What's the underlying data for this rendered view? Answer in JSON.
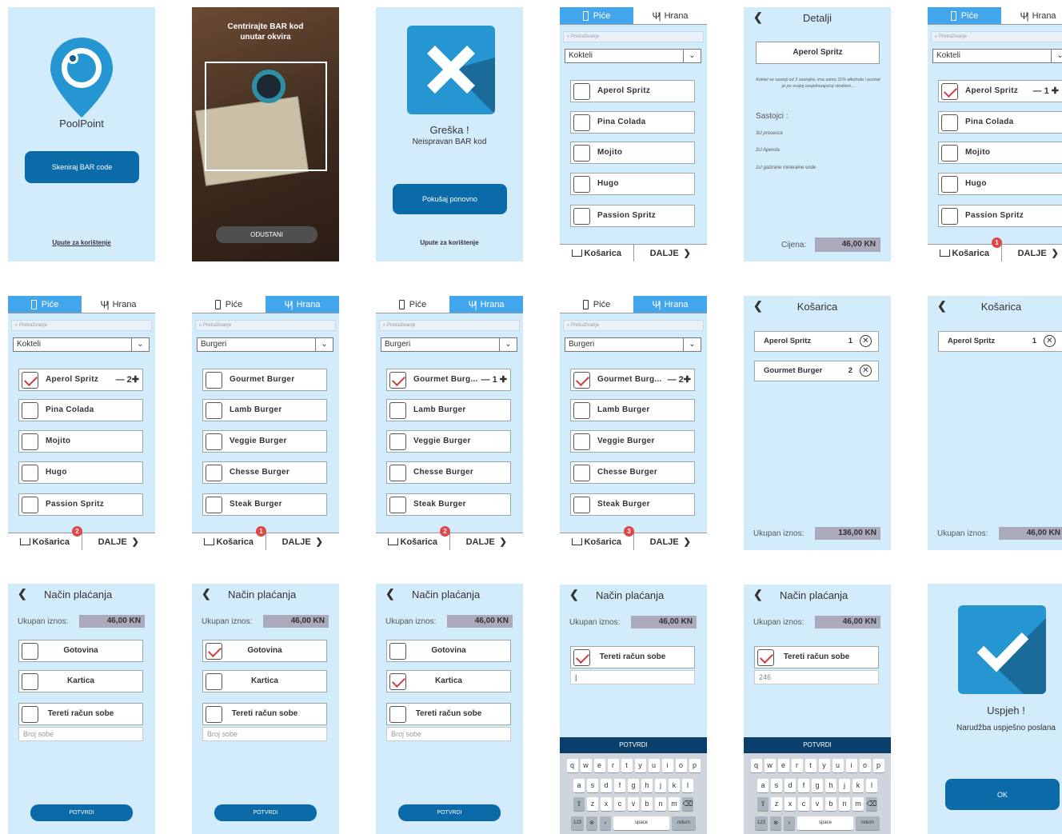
{
  "app": {
    "name": "PoolPoint",
    "scan_button": "Skeniraj BAR code",
    "instructions_link": "Upute za korištenje"
  },
  "scan": {
    "prompt": "Centrirajte BAR kod unutar okvira",
    "cancel": "ODUSTANI"
  },
  "error": {
    "title": "Greška !",
    "message": "Neispravan BAR kod",
    "retry": "Pokušaj ponovno",
    "instructions_link": "Upute za korištenje"
  },
  "tabs": {
    "drinks": "Piće",
    "food": "Hrana"
  },
  "search_placeholder": "Pretraživanje",
  "categories": {
    "cocktails": "Kokteli",
    "burgers": "Burgeri"
  },
  "cocktails": [
    "Aperol Spritz",
    "Pina Colada",
    "Mojito",
    "Hugo",
    "Passion Spritz"
  ],
  "burgers": [
    "Gourmet Burger",
    "Lamb Burger",
    "Veggie Burger",
    "Chesse Burger",
    "Steak Burger"
  ],
  "burger_short": "Gourmet Burg...",
  "bottom": {
    "cart": "Košarica",
    "next": "DALJE"
  },
  "badges": {
    "b5": "1",
    "b6": "2",
    "b7": "1",
    "b8": "2",
    "b9": "3"
  },
  "qty": {
    "q5": "— 1 ✚",
    "q6": "— 2✚",
    "q8": "— 1 ✚",
    "q9": "— 2✚"
  },
  "detail": {
    "header": "Detalji",
    "product": "Aperol Spritz",
    "description": "Koktel se sastoji od 3 sastojka, ima samo 11% alkohola i poznat je po svojoj osvježavajućoj strukturi...",
    "ingredients_title": "Sastojci :",
    "ingredients": [
      "3cl prosecca",
      "2cl Aperola",
      "1cl gazirane mineralne vode"
    ],
    "price_label": "Cijena:",
    "price": "46,00 KN"
  },
  "cart": {
    "header": "Košarica",
    "items": [
      {
        "name": "Aperol Spritz",
        "qty": "1"
      },
      {
        "name": "Gourmet Burger",
        "qty": "2"
      }
    ],
    "total_label": "Ukupan iznos:",
    "total_a": "136,00 KN",
    "total_b": "46,00 KN"
  },
  "payment": {
    "header": "Način plaćanja",
    "total_label": "Ukupan iznos:",
    "total": "46,00 KN",
    "options": {
      "cash": "Gotovina",
      "card": "Kartica",
      "room": "Tereti račun sobe"
    },
    "room_placeholder": "Broj sobe",
    "room_value": "246",
    "confirm": "POTVRDI"
  },
  "keyboard": {
    "row1": [
      "q",
      "w",
      "e",
      "r",
      "t",
      "y",
      "u",
      "i",
      "o",
      "p"
    ],
    "row2": [
      "a",
      "s",
      "d",
      "f",
      "g",
      "h",
      "j",
      "k",
      "l"
    ],
    "row3": [
      "z",
      "x",
      "c",
      "v",
      "b",
      "n",
      "m"
    ],
    "num": "123",
    "space": "space",
    "ret": "return"
  },
  "success": {
    "title": "Uspjeh !",
    "message": "Narudžba uspješno poslana",
    "ok": "OK"
  },
  "colors": {
    "bg": "#d3ecfb",
    "primary": "#0b6aa8",
    "tab_active": "#41a6ec",
    "badge": "#e04848",
    "check": "#d23c3c"
  }
}
